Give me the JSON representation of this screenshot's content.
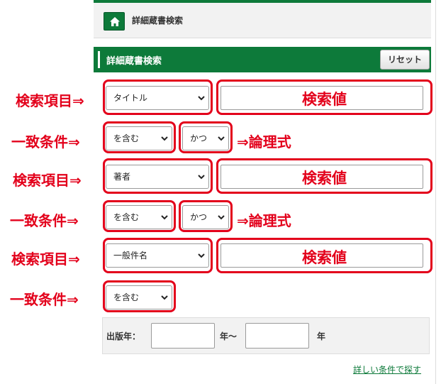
{
  "breadcrumb": {
    "home_icon": "home-icon",
    "current": "詳細蔵書検索"
  },
  "section": {
    "title": "詳細蔵書検索",
    "reset_label": "リセット"
  },
  "rows": [
    {
      "field_selected": "タイトル",
      "match_selected": "を含む",
      "logic_selected": "かつ"
    },
    {
      "field_selected": "著者",
      "match_selected": "を含む",
      "logic_selected": "かつ"
    },
    {
      "field_selected": "一般件名",
      "match_selected": "を含む"
    }
  ],
  "annotations": {
    "field_item": "検索項目⇒",
    "search_value": "検索値",
    "match_condition": "一致条件⇒",
    "logic": "⇒論理式"
  },
  "year": {
    "label": "出版年：",
    "from_suffix": "年〜",
    "to_suffix": "年",
    "from_value": "",
    "to_value": ""
  },
  "links": {
    "more": "詳しい条件で探す"
  },
  "colors": {
    "brand_green": "#0d7a3a",
    "annotation_red": "#e3001b"
  }
}
